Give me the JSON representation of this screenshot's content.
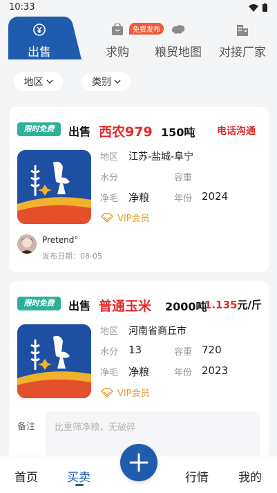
{
  "status_bar": {
    "time": "10:33"
  },
  "top_tabs": [
    {
      "label": "出售",
      "icon": "yen-icon",
      "active": true
    },
    {
      "label": "求购",
      "icon": "shopping-bag-icon",
      "badge": "免费发布"
    },
    {
      "label": "粮贸地图",
      "icon": "china-map-icon"
    },
    {
      "label": "对接厂家",
      "icon": "building-icon"
    }
  ],
  "filters": [
    {
      "label": "地区",
      "icon": "chevron-down-icon"
    },
    {
      "label": "类别",
      "icon": "chevron-down-icon"
    }
  ],
  "listings": [
    {
      "free_tag": "限时免费",
      "type": "出售",
      "crop": "西农979",
      "quantity": "150吨",
      "contact": "电话沟通",
      "logo_text": "粮",
      "fields": [
        {
          "label": "地区",
          "value": "江苏-盐城-阜宁"
        },
        {
          "label": "水分",
          "value": ""
        },
        {
          "label": "容重",
          "value": ""
        },
        {
          "label": "净毛",
          "value": "净粮"
        },
        {
          "label": "年份",
          "value": "2024"
        }
      ],
      "vip": "VIP会员",
      "user": {
        "name": "Pretend°",
        "publish_date": "发布日期：08-05"
      }
    },
    {
      "free_tag": "限时免费",
      "type": "出售",
      "crop": "普通玉米",
      "quantity": "2000吨",
      "price_value": "1.135",
      "price_unit": "元/斤",
      "logo_text": "粮",
      "fields": [
        {
          "label": "地区",
          "value": "河南省商丘市"
        },
        {
          "label": "水分",
          "value": "13"
        },
        {
          "label": "容重",
          "value": "720"
        },
        {
          "label": "净毛",
          "value": "净粮"
        },
        {
          "label": "年份",
          "value": "2023"
        }
      ],
      "vip": "VIP会员",
      "note_label": "备注",
      "note_placeholder": "比重筛净粮，无破碎"
    }
  ],
  "bottom_nav": [
    {
      "label": "首页"
    },
    {
      "label": "买卖",
      "active": true
    },
    {
      "label": "",
      "icon": "plus-icon"
    },
    {
      "label": "行情"
    },
    {
      "label": "我的"
    }
  ],
  "colors": {
    "primary": "#1f5cad",
    "accent_red": "#e32b2b",
    "free_tag": "#2fb09a",
    "vip_gold": "#e19b2a"
  }
}
